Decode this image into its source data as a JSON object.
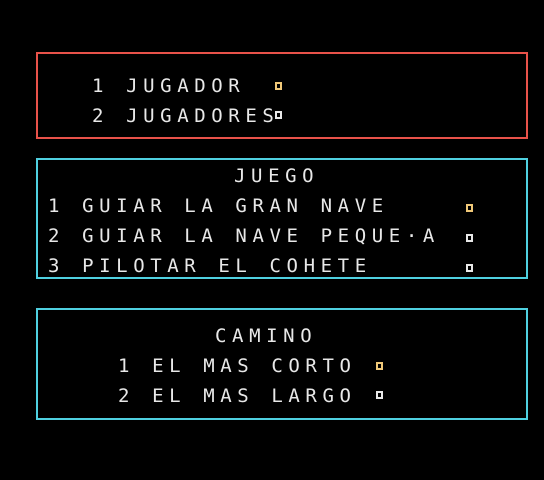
{
  "players": {
    "options": [
      {
        "label": "1 JUGADOR",
        "selected": true
      },
      {
        "label": "2 JUGADORES",
        "selected": false
      }
    ]
  },
  "game": {
    "title": "JUEGO",
    "options": [
      {
        "label": "1 GUIAR LA GRAN NAVE",
        "selected": true
      },
      {
        "label": "2 GUIAR LA NAVE PEQUE·A",
        "selected": false
      },
      {
        "label": "3 PILOTAR EL COHETE",
        "selected": false
      }
    ]
  },
  "route": {
    "title": "CAMINO",
    "options": [
      {
        "label": "1 EL MAS CORTO",
        "selected": true
      },
      {
        "label": "2 EL MAS LARGO",
        "selected": false
      }
    ]
  },
  "colors": {
    "background": "#000000",
    "text": "#e8e8e8",
    "players_border": "#e8524a",
    "menu_border": "#4fd0e0",
    "selected_box": "#f0c878"
  }
}
